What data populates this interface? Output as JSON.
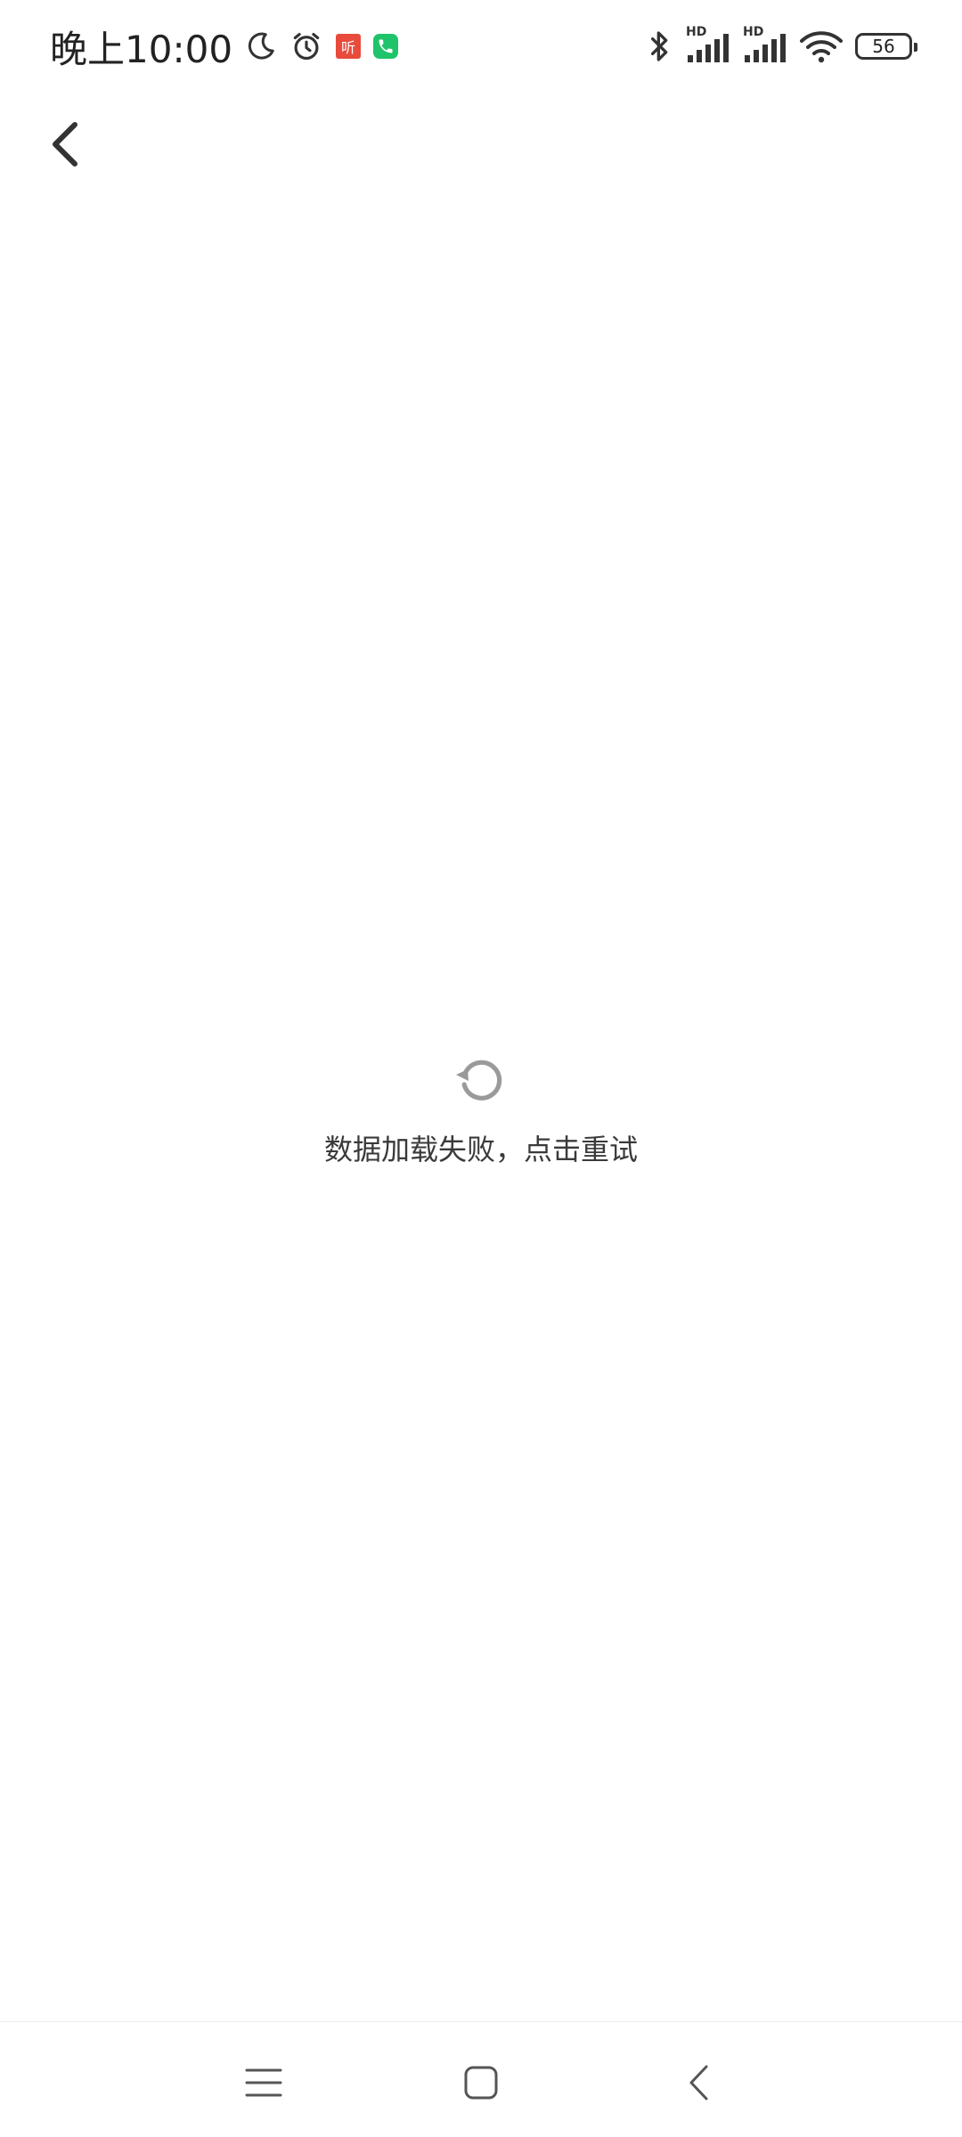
{
  "status_bar": {
    "time": "晚上10:00",
    "notif_red_label": "听",
    "battery": "56",
    "hd1": "HD",
    "hd2": "HD"
  },
  "error": {
    "message": "数据加载失败，点击重试"
  },
  "colors": {
    "text": "#333333",
    "icon_gray": "#9a9a9a",
    "notif_red": "#e84b3c",
    "notif_green": "#1fc46a"
  }
}
